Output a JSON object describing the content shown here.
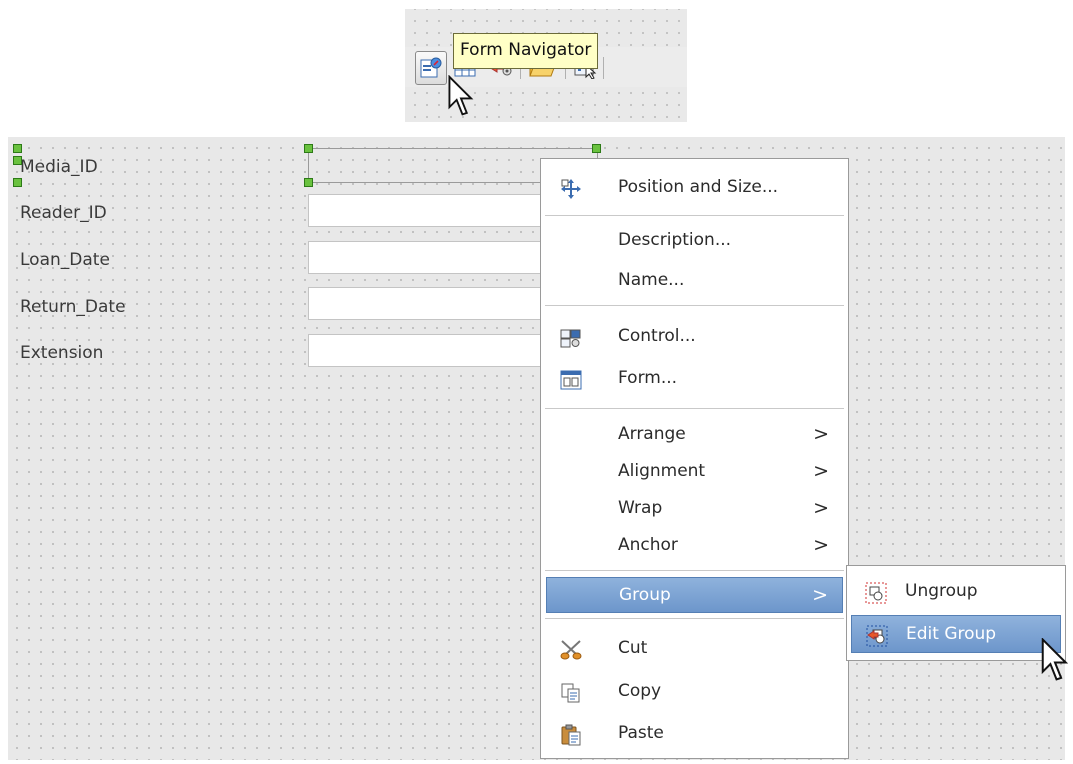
{
  "toolbar": {
    "tooltip": "Form Navigator",
    "buttons": [
      {
        "icon": "form-navigator-icon",
        "active": true
      },
      {
        "icon": "table-icon"
      },
      {
        "icon": "control-properties-icon"
      },
      {
        "icon": "open-folder-icon"
      },
      {
        "icon": "design-mode-icon"
      }
    ]
  },
  "form": {
    "fields": [
      {
        "label": "Media_ID",
        "selected": true
      },
      {
        "label": "Reader_ID"
      },
      {
        "label": "Loan_Date"
      },
      {
        "label": "Return_Date"
      },
      {
        "label": "Extension"
      }
    ],
    "handle_color": "#6ac23f"
  },
  "context_menu": {
    "items": {
      "position_size": "Position and Size...",
      "description": "Description...",
      "name": "Name...",
      "control": "Control...",
      "form": "Form...",
      "arrange": "Arrange",
      "alignment": "Alignment",
      "wrap": "Wrap",
      "anchor": "Anchor",
      "group": "Group",
      "cut": "Cut",
      "copy": "Copy",
      "paste": "Paste"
    },
    "submenu_arrow": ">",
    "highlight_color": "#7aa1d2"
  },
  "group_submenu": {
    "ungroup": "Ungroup",
    "edit_group": "Edit Group"
  }
}
